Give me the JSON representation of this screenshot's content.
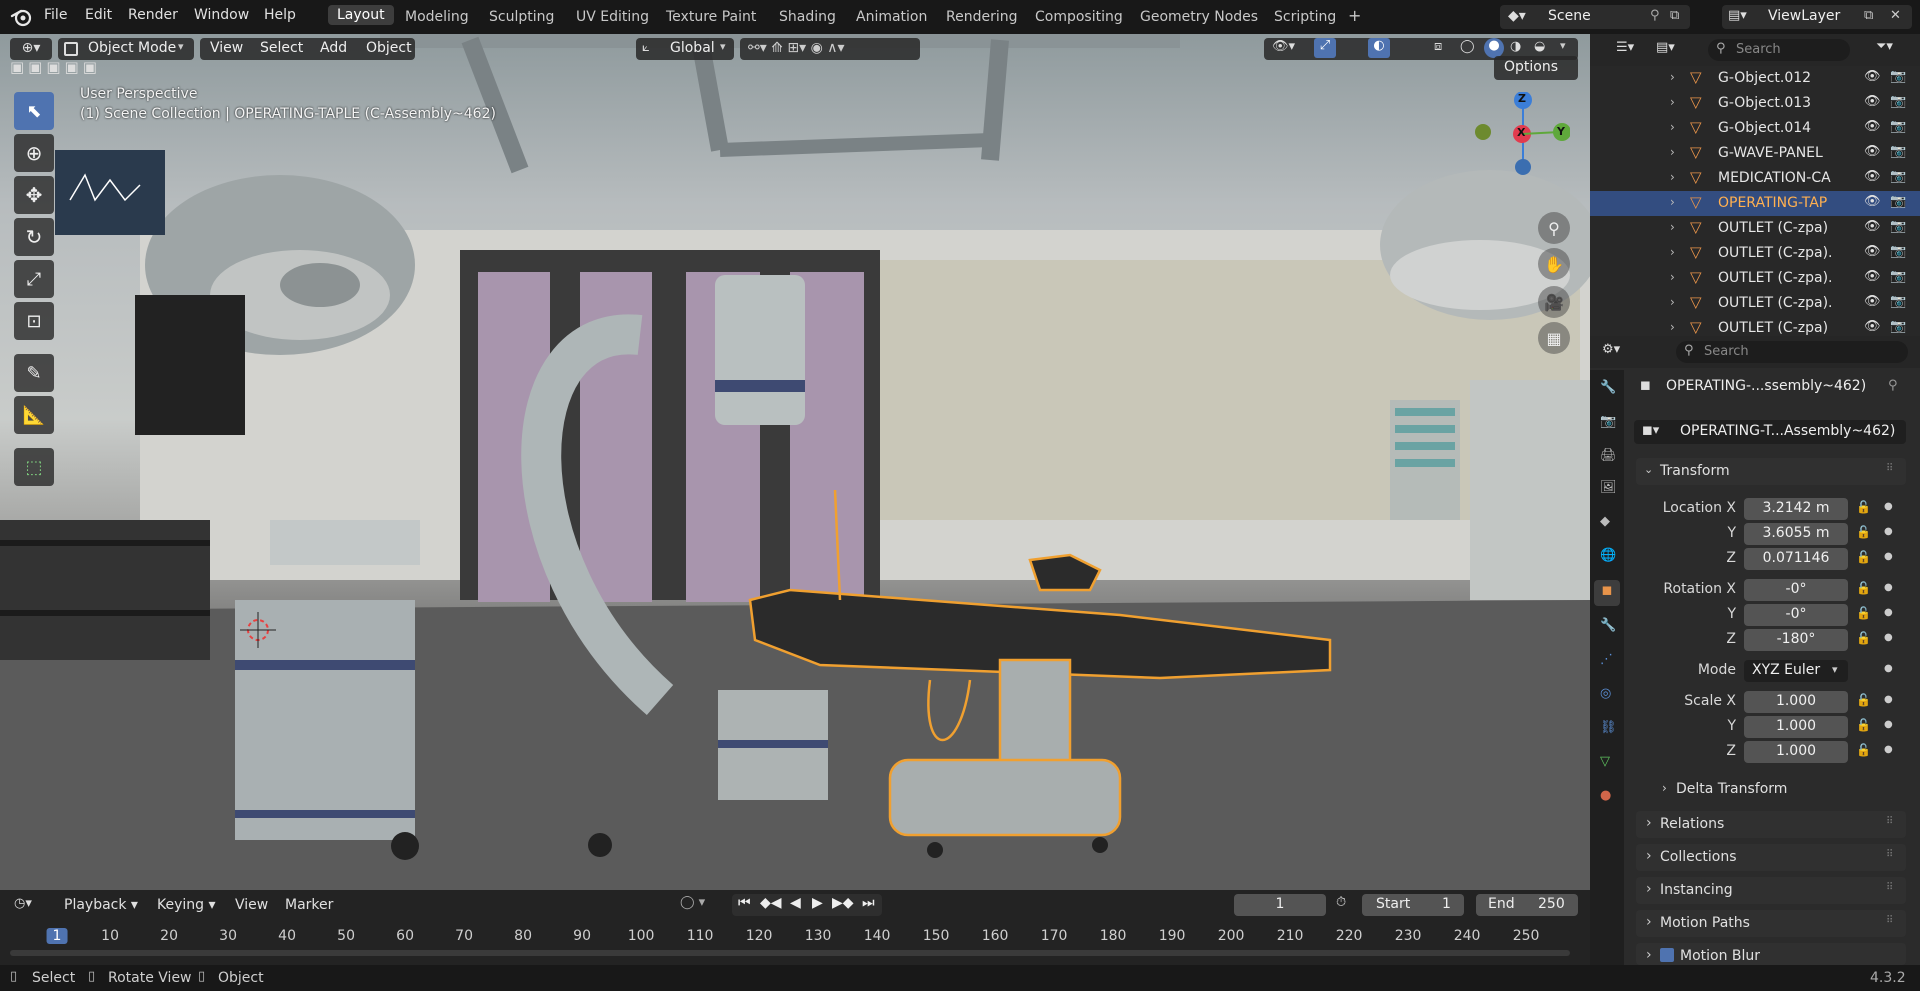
{
  "topbar": {
    "menus": [
      "File",
      "Edit",
      "Render",
      "Window",
      "Help"
    ],
    "workspaces": [
      "Layout",
      "Modeling",
      "Sculpting",
      "UV Editing",
      "Texture Paint",
      "Shading",
      "Animation",
      "Rendering",
      "Compositing",
      "Geometry Nodes",
      "Scripting"
    ],
    "active_workspace": "Layout",
    "add_workspace": "+",
    "scene": "Scene",
    "view_layer": "ViewLayer"
  },
  "viewport_header": {
    "mode": "Object Mode",
    "menus": [
      "View",
      "Select",
      "Add",
      "Object"
    ],
    "transform_orientation": "Global",
    "options": "Options"
  },
  "viewport": {
    "perspective": "User Perspective",
    "collection_info": "(1) Scene Collection | OPERATING-TAPLE (C-Assembly~462)",
    "gizmo": {
      "z": "Z",
      "x": "X",
      "y": "Y"
    }
  },
  "outliner": {
    "search_placeholder": "Search",
    "items": [
      {
        "label": "G-Object.012",
        "selected": false
      },
      {
        "label": "G-Object.013",
        "selected": false
      },
      {
        "label": "G-Object.014",
        "selected": false
      },
      {
        "label": "G-WAVE-PANEL",
        "selected": false
      },
      {
        "label": "MEDICATION-CA",
        "selected": false
      },
      {
        "label": "OPERATING-TAP",
        "selected": true
      },
      {
        "label": "OUTLET (C-zpa)",
        "selected": false
      },
      {
        "label": "OUTLET (C-zpa).",
        "selected": false
      },
      {
        "label": "OUTLET (C-zpa).",
        "selected": false
      },
      {
        "label": "OUTLET (C-zpa).",
        "selected": false
      },
      {
        "label": "OUTLET (C-zpa)",
        "selected": false
      }
    ]
  },
  "properties": {
    "search_placeholder": "Search",
    "object_name": "OPERATING-...ssembly~462)",
    "object_field": "OPERATING-T...Assembly~462)",
    "transform_title": "Transform",
    "location_label": "Location X",
    "location": {
      "x": "3.2142 m",
      "y": "3.6055 m",
      "z": "0.071146"
    },
    "rotation_label": "Rotation X",
    "rotation": {
      "x": "-0°",
      "y": "-0°",
      "z": "-180°"
    },
    "mode_label": "Mode",
    "mode_value": "XYZ Euler",
    "scale_label": "Scale X",
    "scale": {
      "x": "1.000",
      "y": "1.000",
      "z": "1.000"
    },
    "y_label": "Y",
    "z_label": "Z",
    "delta_transform": "Delta Transform",
    "panels": [
      "Relations",
      "Collections",
      "Instancing",
      "Motion Paths",
      "Motion Blur"
    ]
  },
  "timeline": {
    "menus": [
      "Playback",
      "Keying",
      "View",
      "Marker"
    ],
    "current_frame": "1",
    "start_label": "Start",
    "start_value": "1",
    "end_label": "End",
    "end_value": "250",
    "ruler": [
      "1",
      "10",
      "20",
      "30",
      "40",
      "50",
      "60",
      "70",
      "80",
      "90",
      "100",
      "110",
      "120",
      "130",
      "140",
      "150",
      "160",
      "170",
      "180",
      "190",
      "200",
      "210",
      "220",
      "230",
      "240",
      "250"
    ]
  },
  "statusbar": {
    "select": "Select",
    "rotate_view": "Rotate View",
    "object": "Object",
    "version": "4.3.2"
  },
  "colors": {
    "accent": "#4f73b0",
    "selection_outline": "#f0a030",
    "axis_x": "#e23b4e",
    "axis_y": "#5fa83b",
    "axis_z": "#3b7ed8",
    "object_icon": "#e8944a"
  }
}
